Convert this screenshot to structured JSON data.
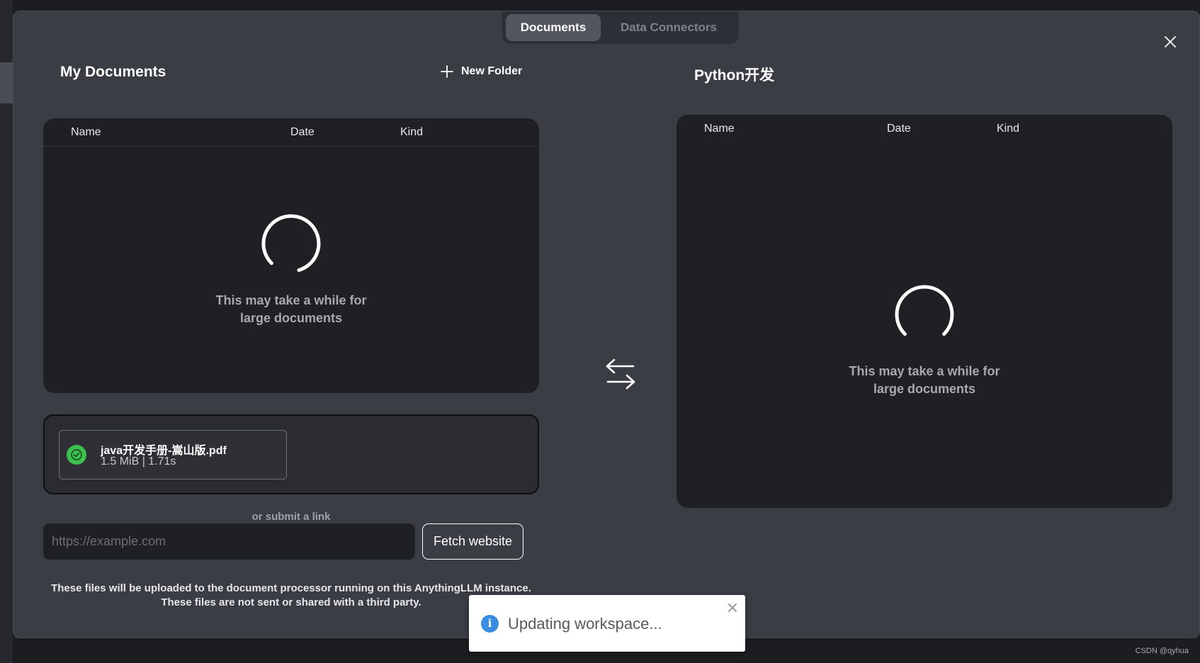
{
  "tabs": [
    {
      "label": "Documents",
      "active": true
    },
    {
      "label": "Data Connectors",
      "active": false
    }
  ],
  "left": {
    "title": "My Documents",
    "new_folder_label": "New Folder",
    "columns": {
      "name": "Name",
      "date": "Date",
      "kind": "Kind"
    },
    "loading_line1": "This may take a while for",
    "loading_line2": "large documents"
  },
  "right": {
    "title": "Python开发",
    "columns": {
      "name": "Name",
      "date": "Date",
      "kind": "Kind"
    },
    "loading_line1": "This may take a while for",
    "loading_line2": "large documents"
  },
  "upload": {
    "file_name": "java开发手册-嵩山版.pdf",
    "file_meta": "1.5 MiB | 1.71s",
    "status_color": "#3cc150"
  },
  "link": {
    "or_text": "or submit a link",
    "placeholder": "https://example.com",
    "value": "",
    "fetch_label": "Fetch website"
  },
  "footnote": {
    "line1": "These files will be uploaded to the document processor running on this AnythingLLM instance.",
    "line2": "These files are not sent or shared with a third party."
  },
  "toast": {
    "message": "Updating workspace...",
    "icon": "info-icon",
    "color": "#3a8de0"
  },
  "watermark": "CSDN @qyhua",
  "icons": {
    "close": "close-icon",
    "new_folder": "plus-icon",
    "swap": "swap-arrows-icon",
    "check": "check-circle-icon",
    "spinner": "loading-spinner-icon"
  }
}
